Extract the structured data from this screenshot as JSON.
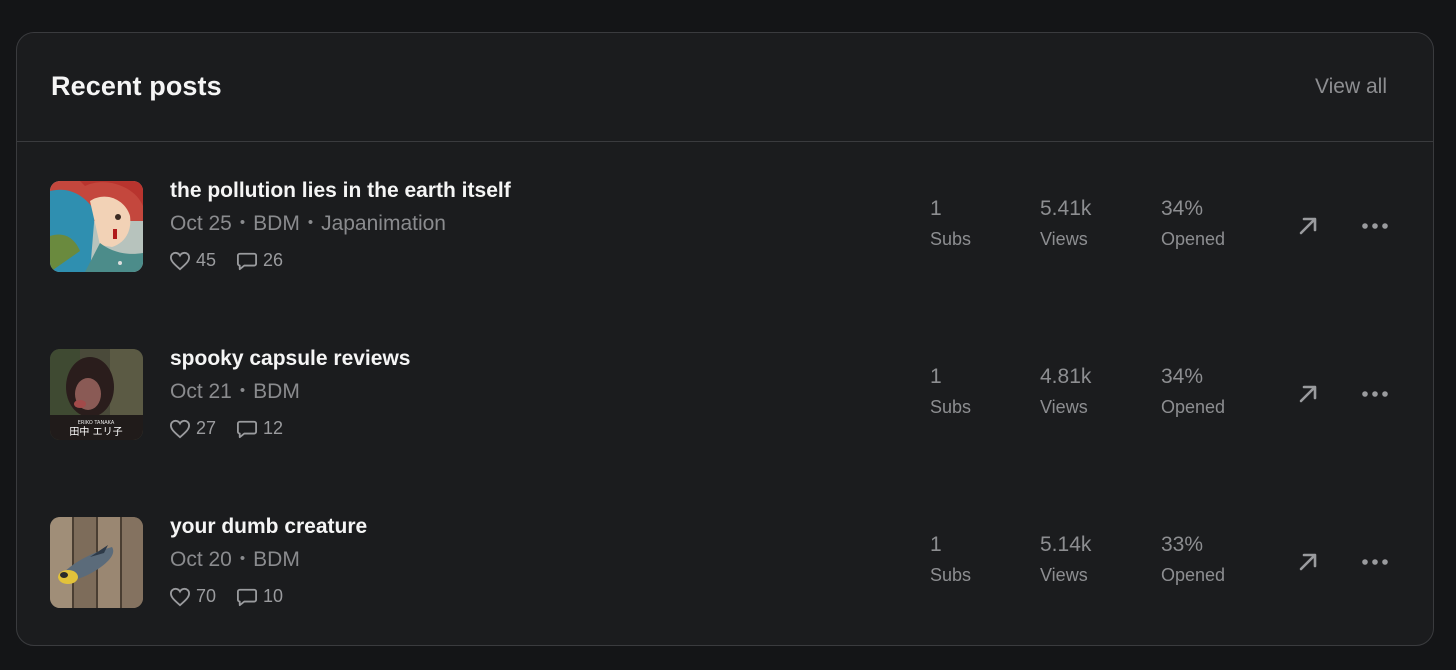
{
  "header": {
    "title": "Recent posts",
    "view_all_label": "View all"
  },
  "posts": [
    {
      "title": "the pollution lies in the earth itself",
      "date": "Oct 25",
      "section": "BDM",
      "tag": "Japanimation",
      "likes": "45",
      "comments": "26",
      "subs_value": "1",
      "subs_label": "Subs",
      "views_value": "5.41k",
      "views_label": "Views",
      "opened_value": "34%",
      "opened_label": "Opened",
      "thumbnail_icon": "anime-character-thumbnail"
    },
    {
      "title": "spooky capsule reviews",
      "date": "Oct 21",
      "section": "BDM",
      "likes": "27",
      "comments": "12",
      "subs_value": "1",
      "subs_label": "Subs",
      "views_value": "4.81k",
      "views_label": "Views",
      "opened_value": "34%",
      "opened_label": "Opened",
      "thumbnail_icon": "album-cover-thumbnail",
      "thumbnail_caption_top": "ERIKO TANAKA",
      "thumbnail_caption_bottom": "田中 エリ子"
    },
    {
      "title": "your dumb creature",
      "date": "Oct 20",
      "section": "BDM",
      "likes": "70",
      "comments": "10",
      "subs_value": "1",
      "subs_label": "Subs",
      "views_value": "5.14k",
      "views_label": "Views",
      "opened_value": "33%",
      "opened_label": "Opened",
      "thumbnail_icon": "bird-on-wood-thumbnail"
    }
  ],
  "icons": {
    "like": "heart-icon",
    "comment": "comment-bubble-icon",
    "open": "arrow-up-right-icon",
    "more": "ellipsis-icon"
  },
  "colors": {
    "page_bg": "#141517",
    "card_bg": "#1b1c1e",
    "border": "#3a3b3e",
    "text_primary": "#f5f5f5",
    "text_muted": "#8d8e91"
  }
}
